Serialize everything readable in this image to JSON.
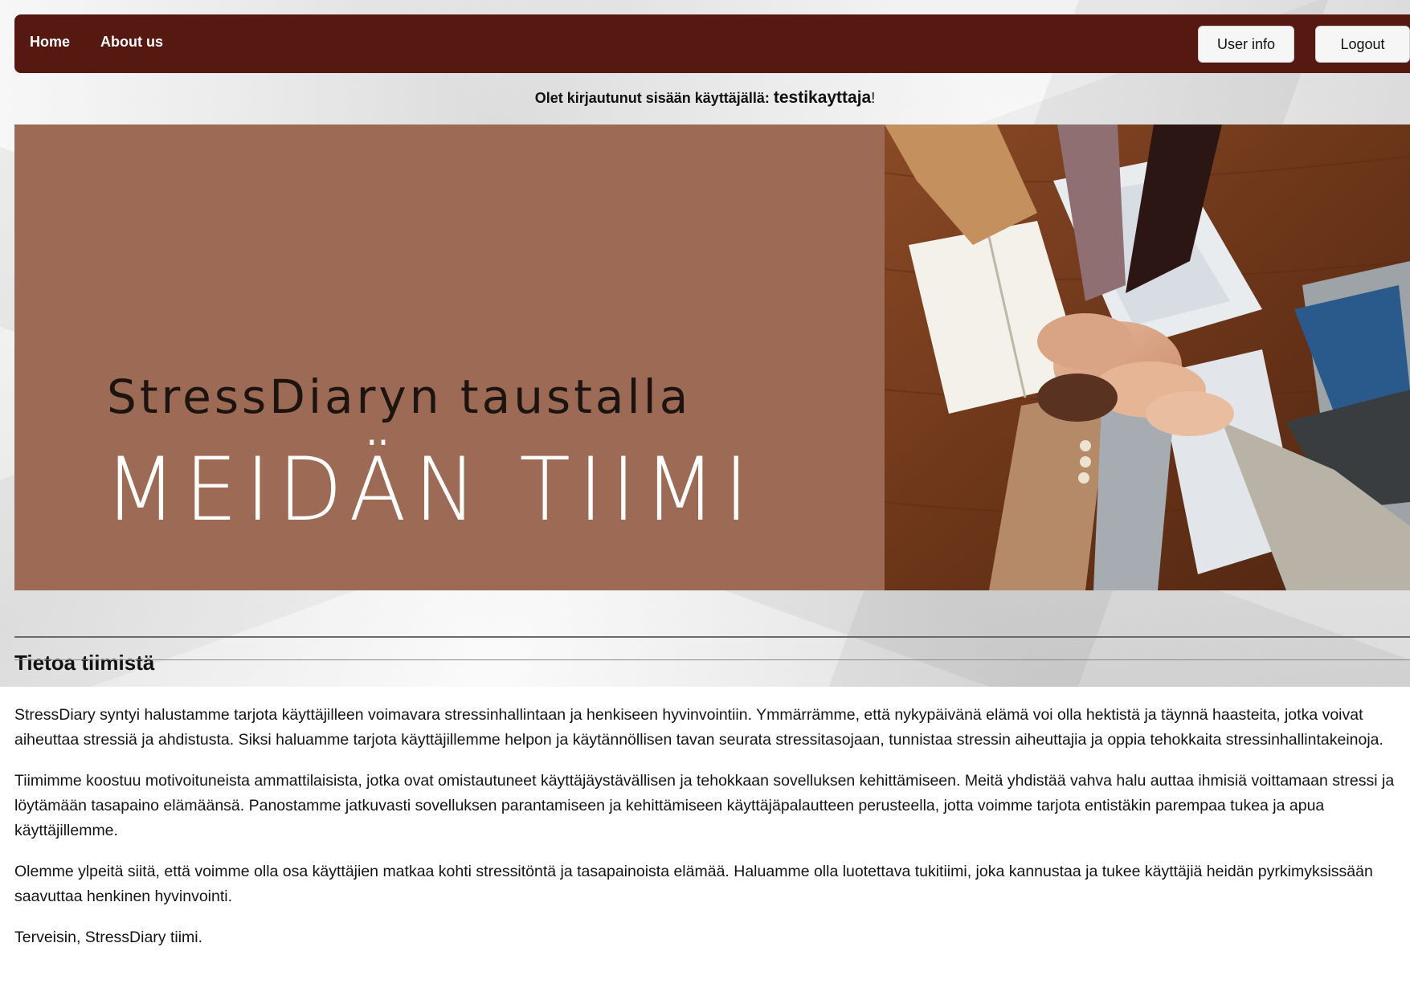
{
  "nav": {
    "home_label": "Home",
    "about_label": "About us",
    "user_info_label": "User info",
    "logout_label": "Logout",
    "background_color": "#561912"
  },
  "login_status": {
    "prefix": "Olet kirjautunut sisään käyttäjällä: ",
    "username": "testikayttaja",
    "suffix": "!"
  },
  "hero": {
    "subtitle": "StressDiaryn taustalla",
    "title": "MEIDÄN TIIMI",
    "panel_color": "#9d6b55",
    "image_description_icon": "team-hands-photo"
  },
  "section": {
    "title": "Tietoa tiimistä"
  },
  "paragraphs": [
    "StressDiary syntyi halustamme tarjota käyttäjilleen voimavara stressinhallintaan ja henkiseen hyvinvointiin. Ymmärrämme, että nykypäivänä elämä voi olla hektistä ja täynnä haasteita, jotka voivat aiheuttaa stressiä ja ahdistusta. Siksi haluamme tarjota käyttäjillemme helpon ja käytännöllisen tavan seurata stressitasojaan, tunnistaa stressin aiheuttajia ja oppia tehokkaita stressinhallintakeinoja.",
    "Tiimimme koostuu motivoituneista ammattilaisista, jotka ovat omistautuneet käyttäjäystävällisen ja tehokkaan sovelluksen kehittämiseen. Meitä yhdistää vahva halu auttaa ihmisiä voittamaan stressi ja löytämään tasapaino elämäänsä. Panostamme jatkuvasti sovelluksen parantamiseen ja kehittämiseen käyttäjäpalautteen perusteella, jotta voimme tarjota entistäkin parempaa tukea ja apua käyttäjillemme.",
    "Olemme ylpeitä siitä, että voimme olla osa käyttäjien matkaa kohti stressitöntä ja tasapainoista elämää. Haluamme olla luotettava tukitiimi, joka kannustaa ja tukee käyttäjiä heidän pyrkimyksissään saavuttaa henkinen hyvinvointi.",
    "Terveisin, StressDiary tiimi."
  ]
}
